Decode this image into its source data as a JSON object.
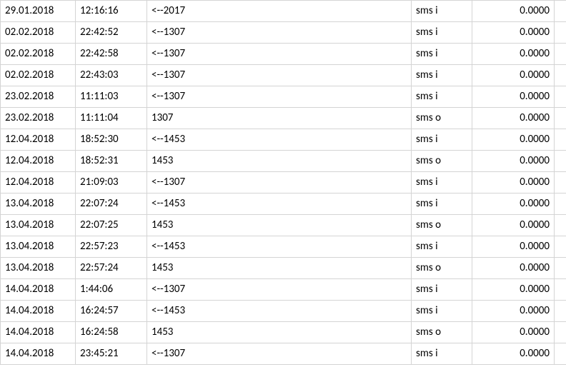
{
  "rows": [
    {
      "date": "29.01.2018",
      "time": "12:16:16",
      "desc": "<--2017",
      "type": "sms i",
      "amount": "0.0000"
    },
    {
      "date": "02.02.2018",
      "time": "22:42:52",
      "desc": "<--1307",
      "type": "sms i",
      "amount": "0.0000"
    },
    {
      "date": "02.02.2018",
      "time": "22:42:58",
      "desc": "<--1307",
      "type": "sms i",
      "amount": "0.0000"
    },
    {
      "date": "02.02.2018",
      "time": "22:43:03",
      "desc": "<--1307",
      "type": "sms i",
      "amount": "0.0000"
    },
    {
      "date": "23.02.2018",
      "time": "11:11:03",
      "desc": "<--1307",
      "type": "sms i",
      "amount": "0.0000"
    },
    {
      "date": "23.02.2018",
      "time": "11:11:04",
      "desc": "1307",
      "type": "sms o",
      "amount": "0.0000"
    },
    {
      "date": "12.04.2018",
      "time": "18:52:30",
      "desc": "<--1453",
      "type": "sms i",
      "amount": "0.0000"
    },
    {
      "date": "12.04.2018",
      "time": "18:52:31",
      "desc": "1453",
      "type": "sms o",
      "amount": "0.0000"
    },
    {
      "date": "12.04.2018",
      "time": "21:09:03",
      "desc": "<--1307",
      "type": "sms i",
      "amount": "0.0000"
    },
    {
      "date": "13.04.2018",
      "time": "22:07:24",
      "desc": "<--1453",
      "type": "sms i",
      "amount": "0.0000"
    },
    {
      "date": "13.04.2018",
      "time": "22:07:25",
      "desc": "1453",
      "type": "sms o",
      "amount": "0.0000"
    },
    {
      "date": "13.04.2018",
      "time": "22:57:23",
      "desc": "<--1453",
      "type": "sms i",
      "amount": "0.0000"
    },
    {
      "date": "13.04.2018",
      "time": "22:57:24",
      "desc": "1453",
      "type": "sms o",
      "amount": "0.0000"
    },
    {
      "date": "14.04.2018",
      "time": "1:44:06",
      "desc": "<--1307",
      "type": "sms i",
      "amount": "0.0000"
    },
    {
      "date": "14.04.2018",
      "time": "16:24:57",
      "desc": "<--1453",
      "type": "sms i",
      "amount": "0.0000"
    },
    {
      "date": "14.04.2018",
      "time": "16:24:58",
      "desc": "1453",
      "type": "sms o",
      "amount": "0.0000"
    },
    {
      "date": "14.04.2018",
      "time": "23:45:21",
      "desc": "<--1307",
      "type": "sms i",
      "amount": "0.0000"
    }
  ]
}
